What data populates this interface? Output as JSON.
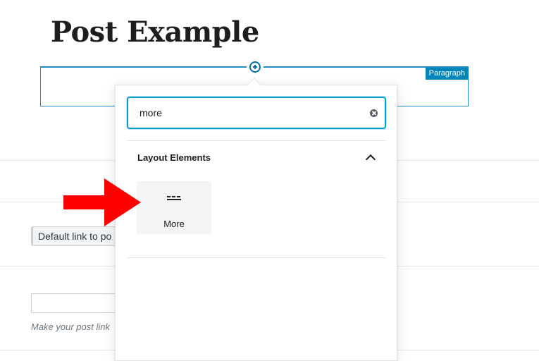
{
  "editor": {
    "post_title": "Post Example",
    "block_badge": "Paragraph"
  },
  "sidebar": {
    "default_link_label": "Default link to po",
    "help_text": "Make your post link"
  },
  "inserter": {
    "search": {
      "value": "more"
    },
    "section_title": "Layout Elements",
    "items": [
      {
        "label": "More",
        "icon": "more-icon"
      }
    ]
  },
  "annotation": {
    "arrow_color": "#ff0000"
  },
  "colors": {
    "accent": "#0085ba",
    "focus": "#00a0d2"
  }
}
